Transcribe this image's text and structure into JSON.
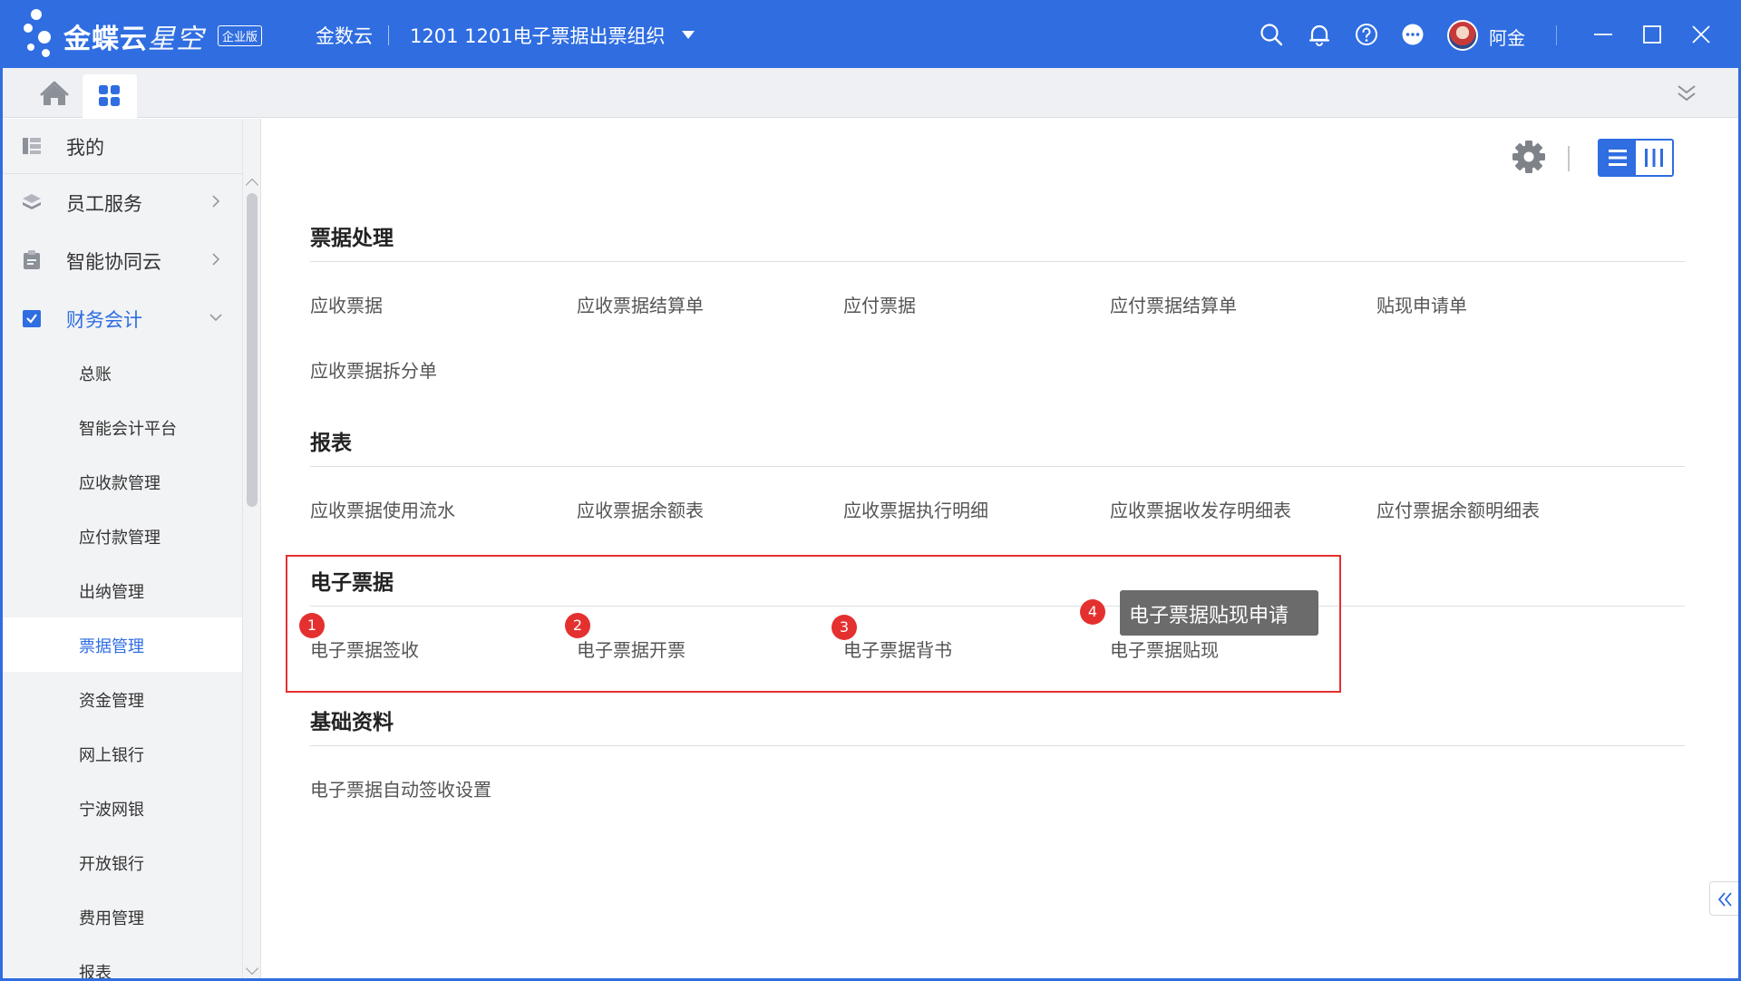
{
  "titlebar": {
    "brand": "金蝶云",
    "brand_sub": "星空",
    "edition": "企业版",
    "cloud_label": "金数云",
    "org_label": "1201  1201电子票据出票组织",
    "user": "阿金"
  },
  "sidebar": {
    "items": [
      {
        "label": "我的"
      },
      {
        "label": "员工服务"
      },
      {
        "label": "智能协同云"
      },
      {
        "label": "财务会计"
      }
    ],
    "sub_items": [
      {
        "label": "总账"
      },
      {
        "label": "智能会计平台"
      },
      {
        "label": "应收款管理"
      },
      {
        "label": "应付款管理"
      },
      {
        "label": "出纳管理"
      },
      {
        "label": "票据管理"
      },
      {
        "label": "资金管理"
      },
      {
        "label": "网上银行"
      },
      {
        "label": "宁波网银"
      },
      {
        "label": "开放银行"
      },
      {
        "label": "费用管理"
      },
      {
        "label": "报表"
      }
    ]
  },
  "sections": [
    {
      "title": "票据处理",
      "links": [
        "应收票据",
        "应收票据结算单",
        "应付票据",
        "应付票据结算单",
        "贴现申请单",
        "应收票据拆分单"
      ]
    },
    {
      "title": "报表",
      "links": [
        "应收票据使用流水",
        "应收票据余额表",
        "应收票据执行明细",
        "应收票据收发存明细表",
        "应付票据余额明细表"
      ]
    },
    {
      "title": "电子票据",
      "links": [
        "电子票据签收",
        "电子票据开票",
        "电子票据背书",
        "电子票据贴现"
      ]
    },
    {
      "title": "基础资料",
      "links": [
        "电子票据自动签收设置"
      ]
    }
  ],
  "annotations": {
    "badges": [
      "1",
      "2",
      "3",
      "4"
    ],
    "tooltip": "电子票据贴现申请",
    "highlight_color": "#e53030"
  },
  "colors": {
    "accent": "#2f6de1",
    "sidebar_bg": "#f2f3f5"
  }
}
